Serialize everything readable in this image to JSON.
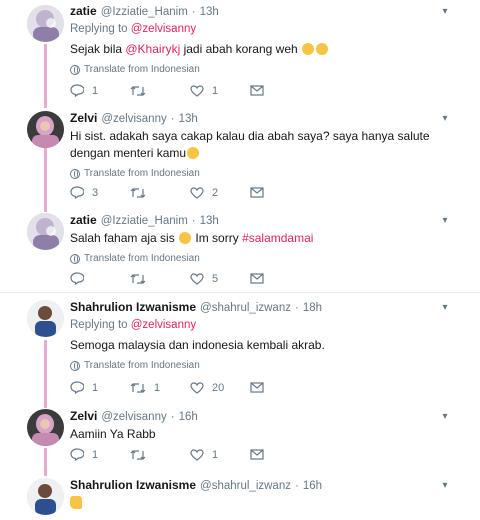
{
  "colors": {
    "link": "#e0245e",
    "muted": "#657786",
    "thread": "#e6aecd"
  },
  "tweets": [
    {
      "name": "zatie",
      "handle": "@Izziatie_Hanim",
      "time": "13h",
      "replying_prefix": "Replying to",
      "replying_to": "@zelvisanny",
      "text_pre": "Sejak bila ",
      "mention": "@Khairykj",
      "text_post": " jadi abah korang weh ",
      "translate": "Translate from Indonesian",
      "reply_count": "1",
      "retweet_count": "",
      "like_count": "1"
    },
    {
      "name": "Zelvi",
      "handle": "@zelvisanny",
      "time": "13h",
      "text": "Hi sist. adakah saya cakap kalau dia abah saya? saya hanya salute dengan menteri kamu",
      "translate": "Translate from Indonesian",
      "reply_count": "3",
      "retweet_count": "",
      "like_count": "2"
    },
    {
      "name": "zatie",
      "handle": "@Izziatie_Hanim",
      "time": "13h",
      "text_pre": "Salah faham aja sis ",
      "text_mid": " Im sorry ",
      "hashtag": "#salamdamai",
      "translate": "Translate from Indonesian",
      "reply_count": "",
      "retweet_count": "",
      "like_count": "5"
    },
    {
      "name": "Shahrulion Izwanisme",
      "handle": "@shahrul_izwanz",
      "time": "18h",
      "replying_prefix": "Replying to",
      "replying_to": "@zelvisanny",
      "text": "Semoga malaysia dan indonesia kembali akrab.",
      "translate": "Translate from Indonesian",
      "reply_count": "1",
      "retweet_count": "1",
      "like_count": "20"
    },
    {
      "name": "Zelvi",
      "handle": "@zelvisanny",
      "time": "16h",
      "text": "Aamiin Ya Rabb",
      "reply_count": "1",
      "retweet_count": "",
      "like_count": "1"
    },
    {
      "name": "Shahrulion Izwanisme",
      "handle": "@shahrul_izwanz",
      "time": "16h"
    }
  ],
  "separator": "·"
}
